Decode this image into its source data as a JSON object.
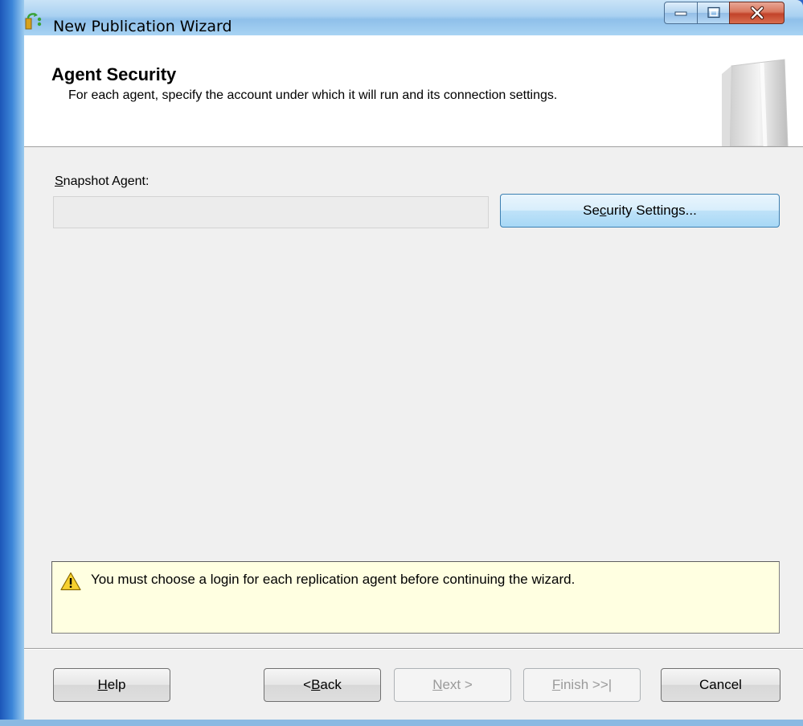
{
  "window": {
    "title": "New Publication Wizard",
    "controls": {
      "minimize": "minimize",
      "maximize": "maximize",
      "close": "close"
    }
  },
  "header": {
    "title": "Agent Security",
    "description": "For each agent, specify the account under which it will run and its connection settings."
  },
  "snapshot_agent": {
    "label_accel": "S",
    "label_rest": "napshot Agent:",
    "account_value": ""
  },
  "security_button": {
    "pre": "Se",
    "accel": "c",
    "post": "urity Settings..."
  },
  "warning": {
    "icon": "warning-triangle-icon",
    "text": "You must choose a login for each replication agent before continuing the wizard."
  },
  "buttons": {
    "help": {
      "accel": "H",
      "rest": "elp"
    },
    "back": {
      "pre": "< ",
      "accel": "B",
      "rest": "ack"
    },
    "next": {
      "accel": "N",
      "rest": "ext >"
    },
    "finish": {
      "accel": "F",
      "rest": "inish >>|"
    },
    "cancel": {
      "label": "Cancel"
    }
  },
  "colors": {
    "warning_background": "#ffffe1",
    "title_bar": "#a9d1f1",
    "close_button": "#c2432a"
  }
}
